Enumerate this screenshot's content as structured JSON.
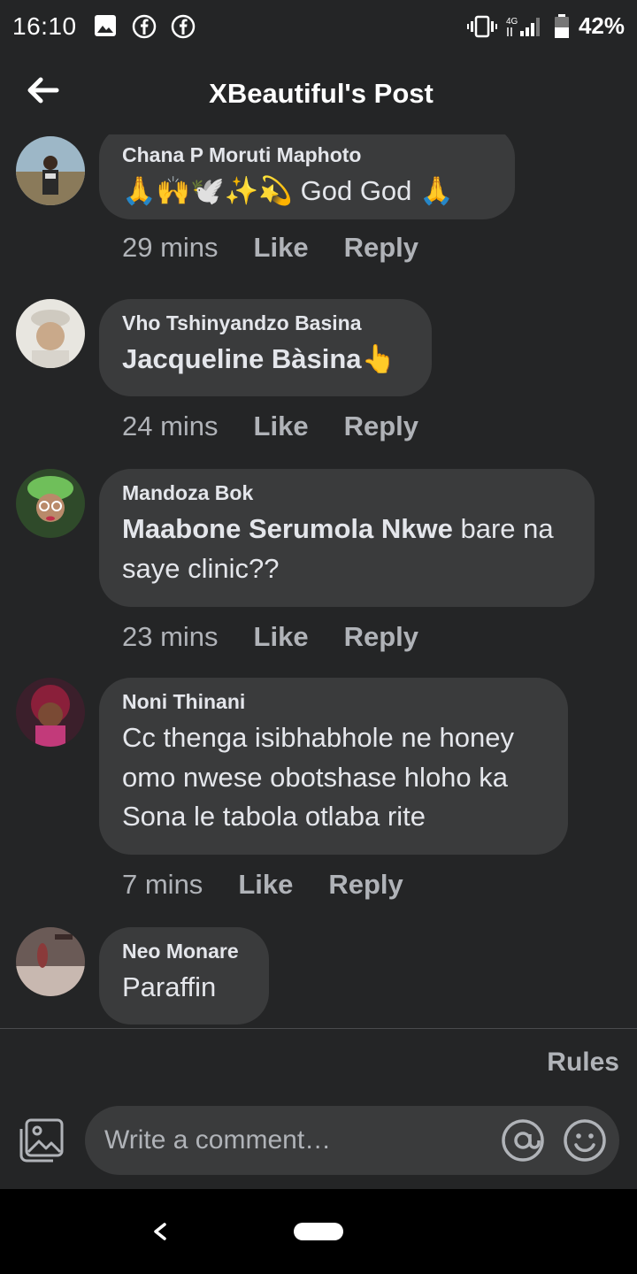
{
  "status_bar": {
    "time": "16:10",
    "network": "4G",
    "battery": "42%",
    "icons": [
      "gallery-icon",
      "facebook-icon",
      "facebook-icon",
      "vibrate-icon",
      "signal-icon",
      "battery-icon"
    ]
  },
  "header": {
    "title": "XBeautiful's Post",
    "back_icon": "arrow-left-icon"
  },
  "comments": [
    {
      "author": "Chana P Moruti Maphoto",
      "emoji_prefix": "🙏🙌🕊️✨💫",
      "text": " God God ",
      "emoji_suffix": "🙏",
      "time": "29 mins",
      "like": "Like",
      "reply": "Reply"
    },
    {
      "author": "Vho Tshinyandzo  Basina",
      "mention": "Jacqueline Bàsina",
      "emoji_suffix": "👆",
      "time": "24 mins",
      "like": "Like",
      "reply": "Reply"
    },
    {
      "author": "Mandoza Bok",
      "mention": "Maabone Serumola Nkwe",
      "text": " bare na saye clinic??",
      "time": "23 mins",
      "like": "Like",
      "reply": "Reply"
    },
    {
      "author": "Noni Thinani",
      "text": "Cc thenga isibhabhole ne honey omo nwese obotshase hloho ka Sona le tabola otlaba rite",
      "time": "7 mins",
      "like": "Like",
      "reply": "Reply"
    },
    {
      "author": "Neo Monare",
      "text": "Paraffin"
    }
  ],
  "footer": {
    "rules": "Rules",
    "comment_placeholder": "Write a comment…",
    "icons": [
      "photo-icon",
      "mention-icon",
      "emoji-icon"
    ]
  },
  "nav": {
    "icons": [
      "nav-back-icon",
      "nav-home-pill"
    ]
  },
  "colors": {
    "background": "#242526",
    "bubble": "#3a3b3c",
    "primary_text": "#e4e6eb",
    "secondary_text": "#b0b3b8"
  }
}
